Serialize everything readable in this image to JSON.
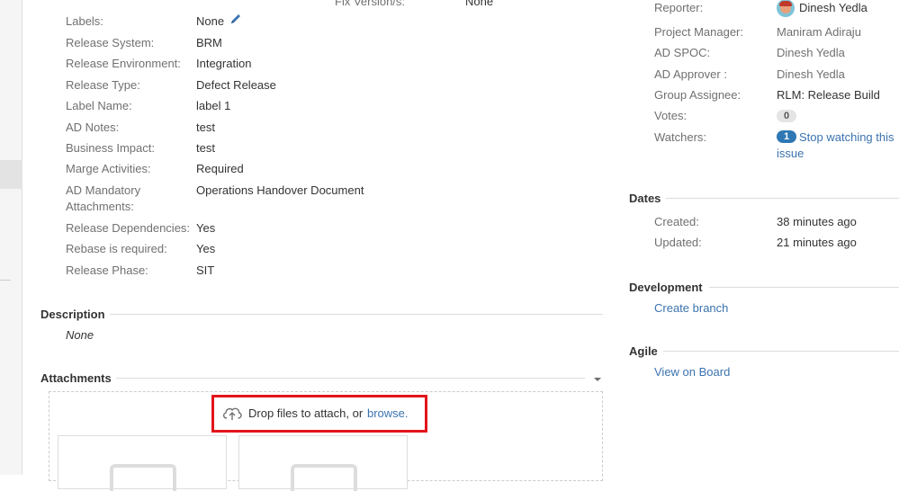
{
  "details": {
    "rows": [
      {
        "label": "Labels:",
        "value": "None"
      },
      {
        "label": "Release System:",
        "value": "BRM"
      },
      {
        "label": "Release Environment:",
        "value": "Integration"
      },
      {
        "label": "Release Type:",
        "value": "Defect Release"
      },
      {
        "label": "Label Name:",
        "value": "label 1"
      },
      {
        "label": "AD Notes:",
        "value": "test"
      },
      {
        "label": "Business Impact:",
        "value": "test"
      },
      {
        "label": "Marge Activities:",
        "value": "Required"
      },
      {
        "label": "AD Mandatory",
        "label2": "Attachments:",
        "value": "Operations Handover Document"
      },
      {
        "label": "Release Dependencies:",
        "value": "Yes"
      },
      {
        "label": "Rebase is required:",
        "value": "Yes"
      },
      {
        "label": "Release Phase:",
        "value": "SIT"
      }
    ],
    "fix_version": {
      "label": "Fix Version/s:",
      "value": "None"
    }
  },
  "description": {
    "heading": "Description",
    "value": "None"
  },
  "attachments": {
    "heading": "Attachments",
    "drop_text": "Drop files to attach, or ",
    "browse_text": "browse."
  },
  "people": {
    "reporter": {
      "label": "Reporter:",
      "value": "Dinesh Yedla"
    },
    "project_manager": {
      "label": "Project Manager:",
      "value": "Maniram Adiraju"
    },
    "ad_spoc": {
      "label": "AD SPOC:",
      "value": "Dinesh Yedla"
    },
    "ad_approver": {
      "label": "AD Approver :",
      "value": "Dinesh Yedla"
    },
    "group_assignee": {
      "label": "Group Assignee:",
      "value": "RLM: Release Build"
    },
    "votes": {
      "label": "Votes:",
      "count": "0"
    },
    "watchers": {
      "label": "Watchers:",
      "count": "1",
      "link_line1": "Stop watching this",
      "link_line2": "issue"
    }
  },
  "dates": {
    "heading": "Dates",
    "created": {
      "label": "Created:",
      "value": "38 minutes ago"
    },
    "updated": {
      "label": "Updated:",
      "value": "21 minutes ago"
    }
  },
  "development": {
    "heading": "Development",
    "link": "Create branch"
  },
  "agile": {
    "heading": "Agile",
    "link": "View on Board"
  },
  "colors": {
    "link": "#3b73af",
    "highlight": "#e3151b",
    "badge_blue": "#2f78b4"
  },
  "icons": {
    "edit": "pencil-icon",
    "upload": "cloud-upload-icon"
  }
}
